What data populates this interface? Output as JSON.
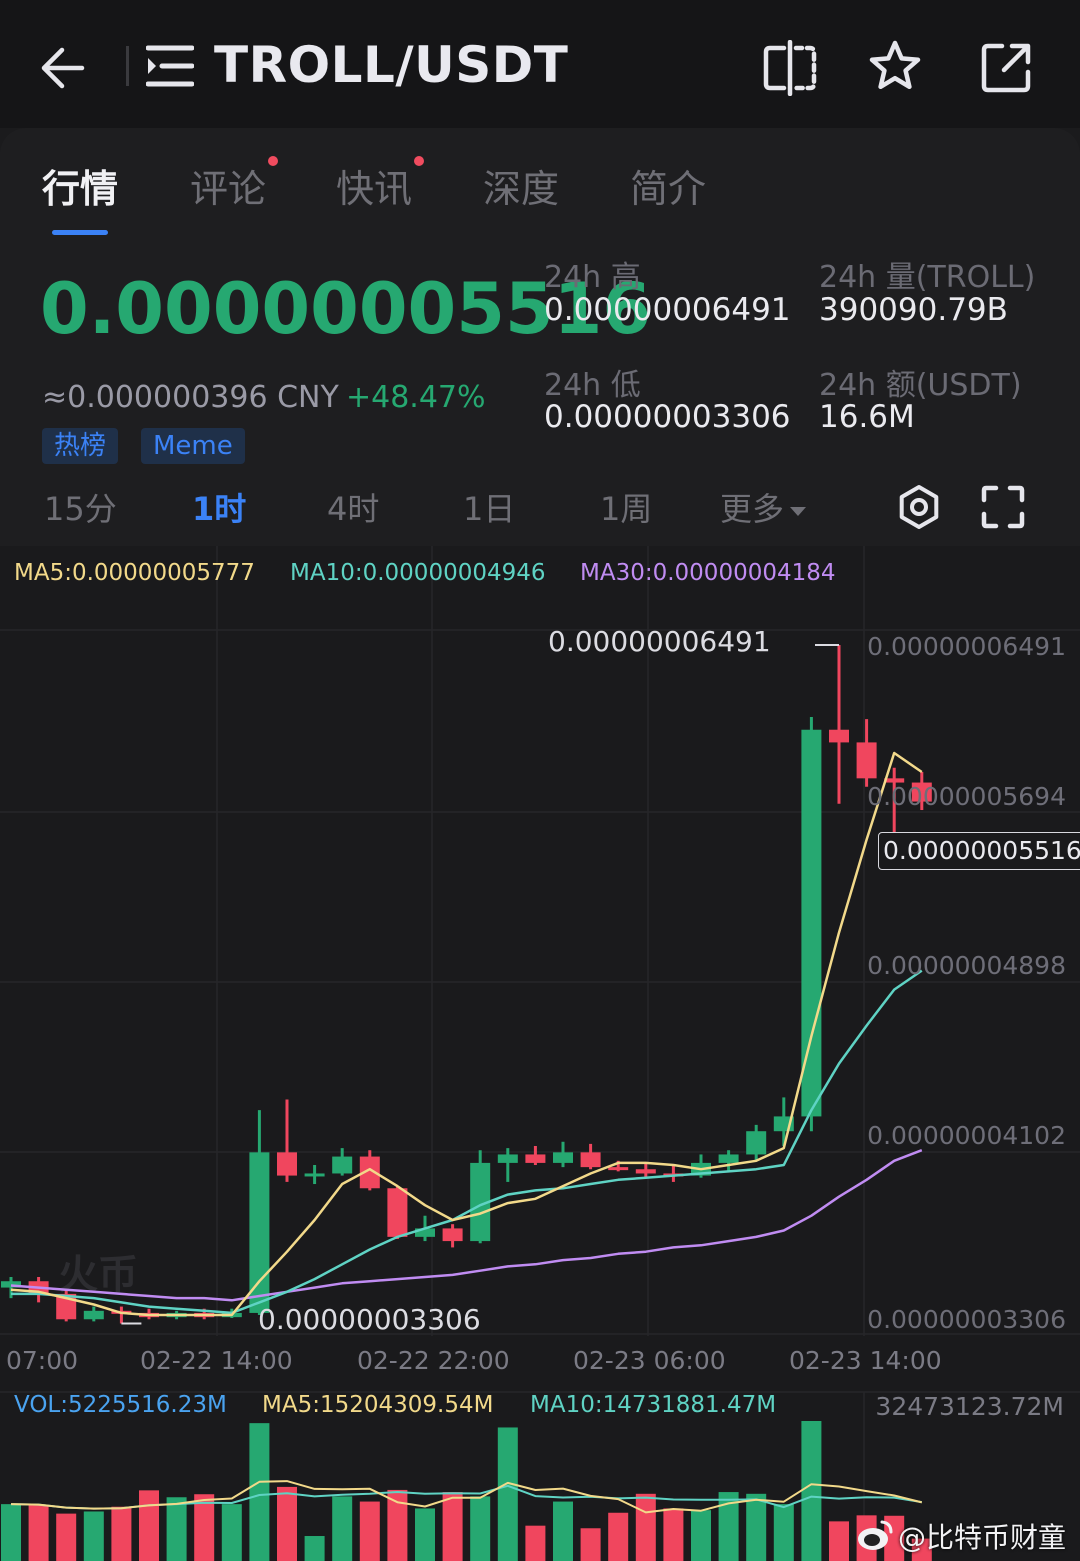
{
  "header": {
    "title": "TROLL/USDT"
  },
  "tabs": [
    {
      "label": "行情",
      "active": true,
      "dot": false
    },
    {
      "label": "评论",
      "active": false,
      "dot": true
    },
    {
      "label": "快讯",
      "active": false,
      "dot": true
    },
    {
      "label": "深度",
      "active": false,
      "dot": false
    },
    {
      "label": "简介",
      "active": false,
      "dot": false
    }
  ],
  "ticker": {
    "last_price": "0.00000005516",
    "cny": "≈0.000000396 CNY",
    "change_pct": "+48.47%",
    "tags": [
      "热榜",
      "Meme"
    ],
    "high_label": "24h 高",
    "high_value": "0.00000006491",
    "low_label": "24h 低",
    "low_value": "0.00000003306",
    "vol_label": "24h 量(TROLL)",
    "vol_value": "390090.79B",
    "amt_label": "24h 额(USDT)",
    "amt_value": "16.6M"
  },
  "intervals": {
    "items": [
      "15分",
      "1时",
      "4时",
      "1日",
      "1周",
      "更多"
    ],
    "active": "1时"
  },
  "colors": {
    "up": "#26a871",
    "down": "#f0465e",
    "ma5": "#f2d98a",
    "ma10": "#5fd3c4",
    "ma30": "#c08cf2",
    "vol_legend": "#4aa3f0",
    "accent": "#3b82f6"
  },
  "ma_legend": {
    "ma5": "MA5:0.00000005777",
    "ma10": "MA10:0.00000004946",
    "ma30": "MA30:0.00000004184"
  },
  "price_axis": {
    "ticks": [
      "0.00000006491",
      "0.00000005694",
      "0.00000004898",
      "0.00000004102",
      "0.00000003306"
    ],
    "current": "0.00000005516",
    "high_marker": "0.00000006491",
    "low_marker": "0.00000003306"
  },
  "time_axis": [
    "07:00",
    "02-22 14:00",
    "02-22 22:00",
    "02-23 06:00",
    "02-23 14:00"
  ],
  "volume_legend": {
    "vol": "VOL:5225516.23M",
    "ma5": "MA5:15204309.54M",
    "ma10": "MA10:14731881.47M",
    "max": "32473123.72M"
  },
  "watermark": {
    "logo": "火币",
    "credit": "@比特币财童"
  },
  "chart_data": {
    "type": "candlestick",
    "unit": "USDT (×1e-8)",
    "ylim": [
      3.306,
      6.491
    ],
    "candles": [
      {
        "o": 3.45,
        "h": 3.5,
        "l": 3.4,
        "c": 3.48
      },
      {
        "o": 3.48,
        "h": 3.5,
        "l": 3.38,
        "c": 3.42
      },
      {
        "o": 3.42,
        "h": 3.44,
        "l": 3.29,
        "c": 3.3
      },
      {
        "o": 3.3,
        "h": 3.36,
        "l": 3.29,
        "c": 3.34
      },
      {
        "o": 3.34,
        "h": 3.36,
        "l": 3.28,
        "c": 3.33
      },
      {
        "o": 3.33,
        "h": 3.35,
        "l": 3.3,
        "c": 3.31
      },
      {
        "o": 3.31,
        "h": 3.34,
        "l": 3.3,
        "c": 3.33
      },
      {
        "o": 3.33,
        "h": 3.35,
        "l": 3.3,
        "c": 3.31
      },
      {
        "o": 3.31,
        "h": 3.35,
        "l": 3.306,
        "c": 3.33
      },
      {
        "o": 3.33,
        "h": 4.29,
        "l": 3.32,
        "c": 4.09
      },
      {
        "o": 4.09,
        "h": 4.34,
        "l": 3.95,
        "c": 3.98
      },
      {
        "o": 3.98,
        "h": 4.03,
        "l": 3.94,
        "c": 3.99
      },
      {
        "o": 3.99,
        "h": 4.11,
        "l": 3.98,
        "c": 4.07
      },
      {
        "o": 4.07,
        "h": 4.1,
        "l": 3.91,
        "c": 3.92
      },
      {
        "o": 3.92,
        "h": 3.93,
        "l": 3.68,
        "c": 3.69
      },
      {
        "o": 3.69,
        "h": 3.79,
        "l": 3.67,
        "c": 3.73
      },
      {
        "o": 3.73,
        "h": 3.75,
        "l": 3.64,
        "c": 3.67
      },
      {
        "o": 3.67,
        "h": 4.1,
        "l": 3.66,
        "c": 4.04
      },
      {
        "o": 4.04,
        "h": 4.11,
        "l": 3.95,
        "c": 4.08
      },
      {
        "o": 4.08,
        "h": 4.12,
        "l": 4.03,
        "c": 4.04
      },
      {
        "o": 4.04,
        "h": 4.14,
        "l": 4.02,
        "c": 4.09
      },
      {
        "o": 4.09,
        "h": 4.13,
        "l": 4.01,
        "c": 4.02
      },
      {
        "o": 4.02,
        "h": 4.05,
        "l": 4.0,
        "c": 4.01
      },
      {
        "o": 4.01,
        "h": 4.04,
        "l": 3.97,
        "c": 3.99
      },
      {
        "o": 3.99,
        "h": 4.03,
        "l": 3.95,
        "c": 3.98
      },
      {
        "o": 3.98,
        "h": 4.08,
        "l": 3.97,
        "c": 4.04
      },
      {
        "o": 4.04,
        "h": 4.1,
        "l": 4.0,
        "c": 4.08
      },
      {
        "o": 4.08,
        "h": 4.22,
        "l": 4.05,
        "c": 4.19
      },
      {
        "o": 4.19,
        "h": 4.35,
        "l": 4.12,
        "c": 4.26
      },
      {
        "o": 4.26,
        "h": 6.15,
        "l": 4.19,
        "c": 6.09
      },
      {
        "o": 6.09,
        "h": 6.491,
        "l": 5.74,
        "c": 6.03
      },
      {
        "o": 6.03,
        "h": 6.14,
        "l": 5.82,
        "c": 5.86
      },
      {
        "o": 5.86,
        "h": 5.91,
        "l": 5.53,
        "c": 5.84
      },
      {
        "o": 5.84,
        "h": 5.89,
        "l": 5.71,
        "c": 5.75
      }
    ],
    "ma5": [
      3.44,
      3.43,
      3.4,
      3.37,
      3.33,
      3.32,
      3.32,
      3.32,
      3.32,
      3.48,
      3.62,
      3.77,
      3.94,
      4.01,
      3.93,
      3.84,
      3.77,
      3.8,
      3.85,
      3.87,
      3.93,
      3.99,
      4.04,
      4.04,
      4.03,
      4.01,
      4.03,
      4.05,
      4.11,
      4.64,
      5.13,
      5.57,
      5.98,
      5.89
    ],
    "ma10": [
      3.42,
      3.42,
      3.41,
      3.4,
      3.38,
      3.36,
      3.35,
      3.34,
      3.33,
      3.38,
      3.43,
      3.49,
      3.56,
      3.63,
      3.69,
      3.73,
      3.77,
      3.84,
      3.89,
      3.91,
      3.92,
      3.94,
      3.96,
      3.97,
      3.98,
      3.99,
      4.0,
      4.01,
      4.03,
      4.29,
      4.51,
      4.69,
      4.86,
      4.95
    ],
    "ma30": [
      3.46,
      3.45,
      3.44,
      3.43,
      3.42,
      3.41,
      3.4,
      3.4,
      3.39,
      3.41,
      3.43,
      3.45,
      3.47,
      3.48,
      3.49,
      3.5,
      3.51,
      3.53,
      3.55,
      3.56,
      3.58,
      3.59,
      3.61,
      3.62,
      3.64,
      3.65,
      3.67,
      3.69,
      3.72,
      3.79,
      3.88,
      3.96,
      4.05,
      4.1
    ],
    "volume": [
      13.2,
      13.0,
      11.0,
      11.5,
      12.6,
      16.4,
      14.8,
      15.5,
      13.2,
      32.0,
      17.2,
      5.8,
      15.0,
      13.8,
      16.5,
      12.2,
      16.0,
      15.0,
      31.0,
      8.2,
      13.8,
      7.6,
      11.2,
      15.6,
      12.2,
      11.8,
      16.0,
      15.6,
      13.2,
      32.5,
      9.2,
      10.6,
      10.5,
      5.2
    ],
    "volume_unit": "M"
  }
}
